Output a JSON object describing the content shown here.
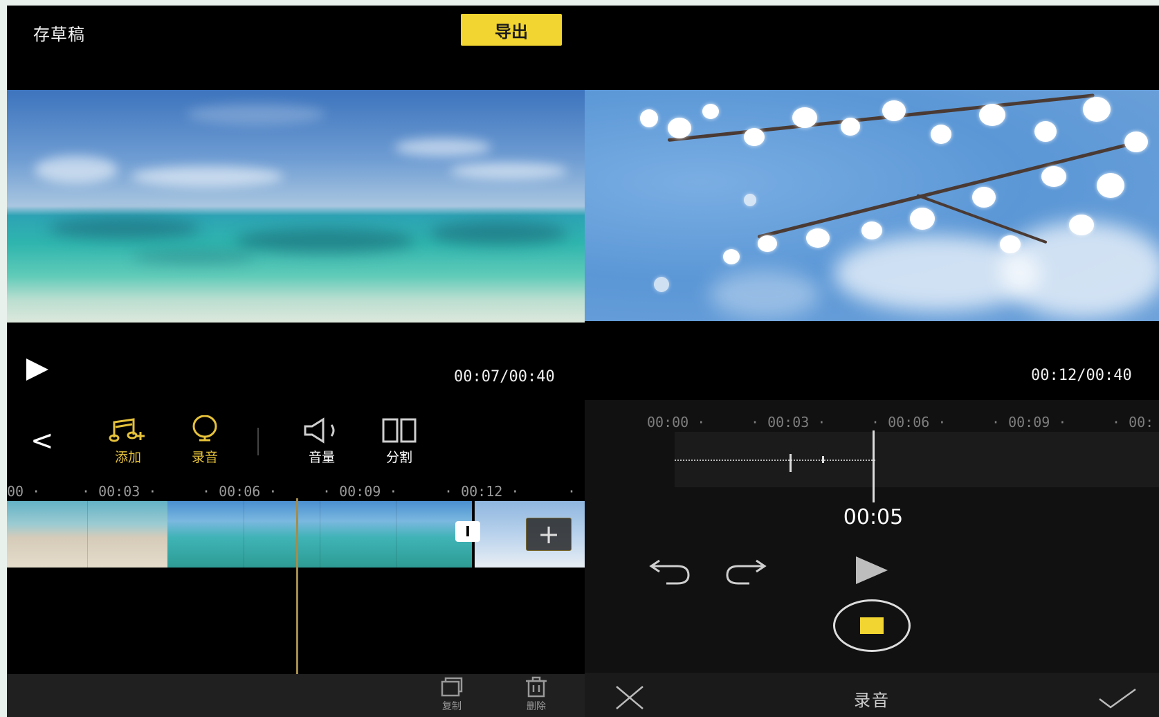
{
  "left_screen": {
    "draft_label": "存草稿",
    "export_label": "导出",
    "timecode": "00:07/00:40",
    "tools": [
      {
        "icon": "music-add-icon",
        "label": "添加"
      },
      {
        "icon": "microphone-icon",
        "label": "录音"
      },
      {
        "icon": "volume-icon",
        "label": "音量"
      },
      {
        "icon": "split-icon",
        "label": "分割"
      }
    ],
    "ruler": [
      "00 ·",
      "· 00:03 ·",
      "· 00:06 ·",
      "· 00:09 ·",
      "· 00:12 ·",
      "·"
    ],
    "transition_label": "I",
    "add_clip_label": "+",
    "bottom_actions": [
      {
        "icon": "copy-icon",
        "label": "复制"
      },
      {
        "icon": "delete-icon",
        "label": "删除"
      }
    ]
  },
  "right_screen": {
    "timecode": "00:12/00:40",
    "ruler": [
      "00:00 ·",
      "· 00:03 ·",
      "· 00:06 ·",
      "· 00:09 ·",
      "· 00:"
    ],
    "current_time": "00:05",
    "title": "录音",
    "accent_color": "#f2d530"
  }
}
